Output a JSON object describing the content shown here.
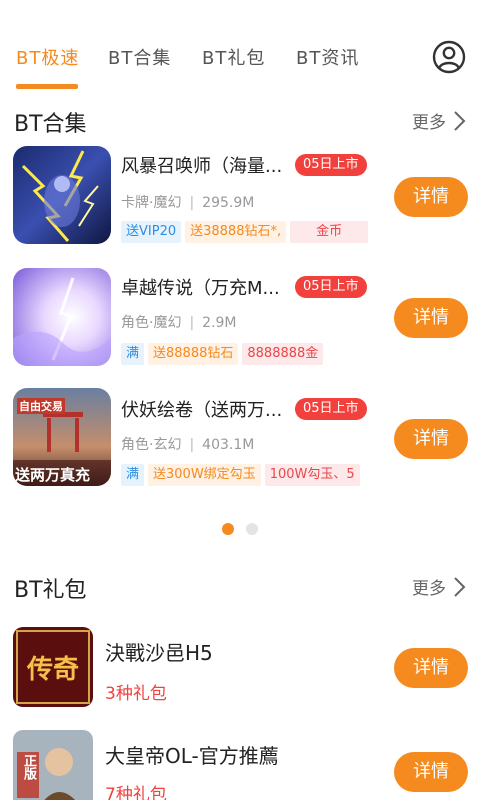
{
  "tabs": [
    {
      "label": "BT极速",
      "active": true
    },
    {
      "label": "BT合集",
      "active": false
    },
    {
      "label": "BT礼包",
      "active": false
    },
    {
      "label": "BT资讯",
      "active": false
    }
  ],
  "icons": {
    "user": "user-circle-icon",
    "chevron": "chevron-right-icon"
  },
  "colors": {
    "accent": "#f58a1f",
    "badge": "#f2413c",
    "tag_blue": "#2e8ee0"
  },
  "collection": {
    "title": "BT合集",
    "more_label": "更多",
    "games": [
      {
        "name": "风暴召唤师（海量...",
        "badge": "05日上市",
        "category": "卡牌·魔幻",
        "size": "295.9M",
        "tags": [
          "送VIP20",
          "送38888钻石*,",
          "金币"
        ],
        "button": "详情"
      },
      {
        "name": "卓越传说（万充M...",
        "badge": "05日上市",
        "category": "角色·魔幻",
        "size": "2.9M",
        "tags": [
          "满",
          "送88888钻石",
          "8888888金"
        ],
        "button": "详情"
      },
      {
        "name": "伏妖绘卷（送两万...",
        "badge": "05日上市",
        "category": "角色·玄幻",
        "size": "403.1M",
        "tags": [
          "满",
          "送300W绑定勾玉",
          "100W勾玉、5"
        ],
        "thumb_text": [
          "自由交易",
          "送两万真充"
        ],
        "button": "详情"
      }
    ],
    "pager": {
      "count": 2,
      "active": 1
    }
  },
  "gifts": {
    "title": "BT礼包",
    "more_label": "更多",
    "items": [
      {
        "name": "決戰沙邑H5",
        "count": "3种礼包",
        "thumb_text": "传奇",
        "button": "详情"
      },
      {
        "name": "大皇帝OL-官方推薦",
        "count": "7种礼包",
        "thumb_text": "正版",
        "button": "详情"
      }
    ]
  }
}
